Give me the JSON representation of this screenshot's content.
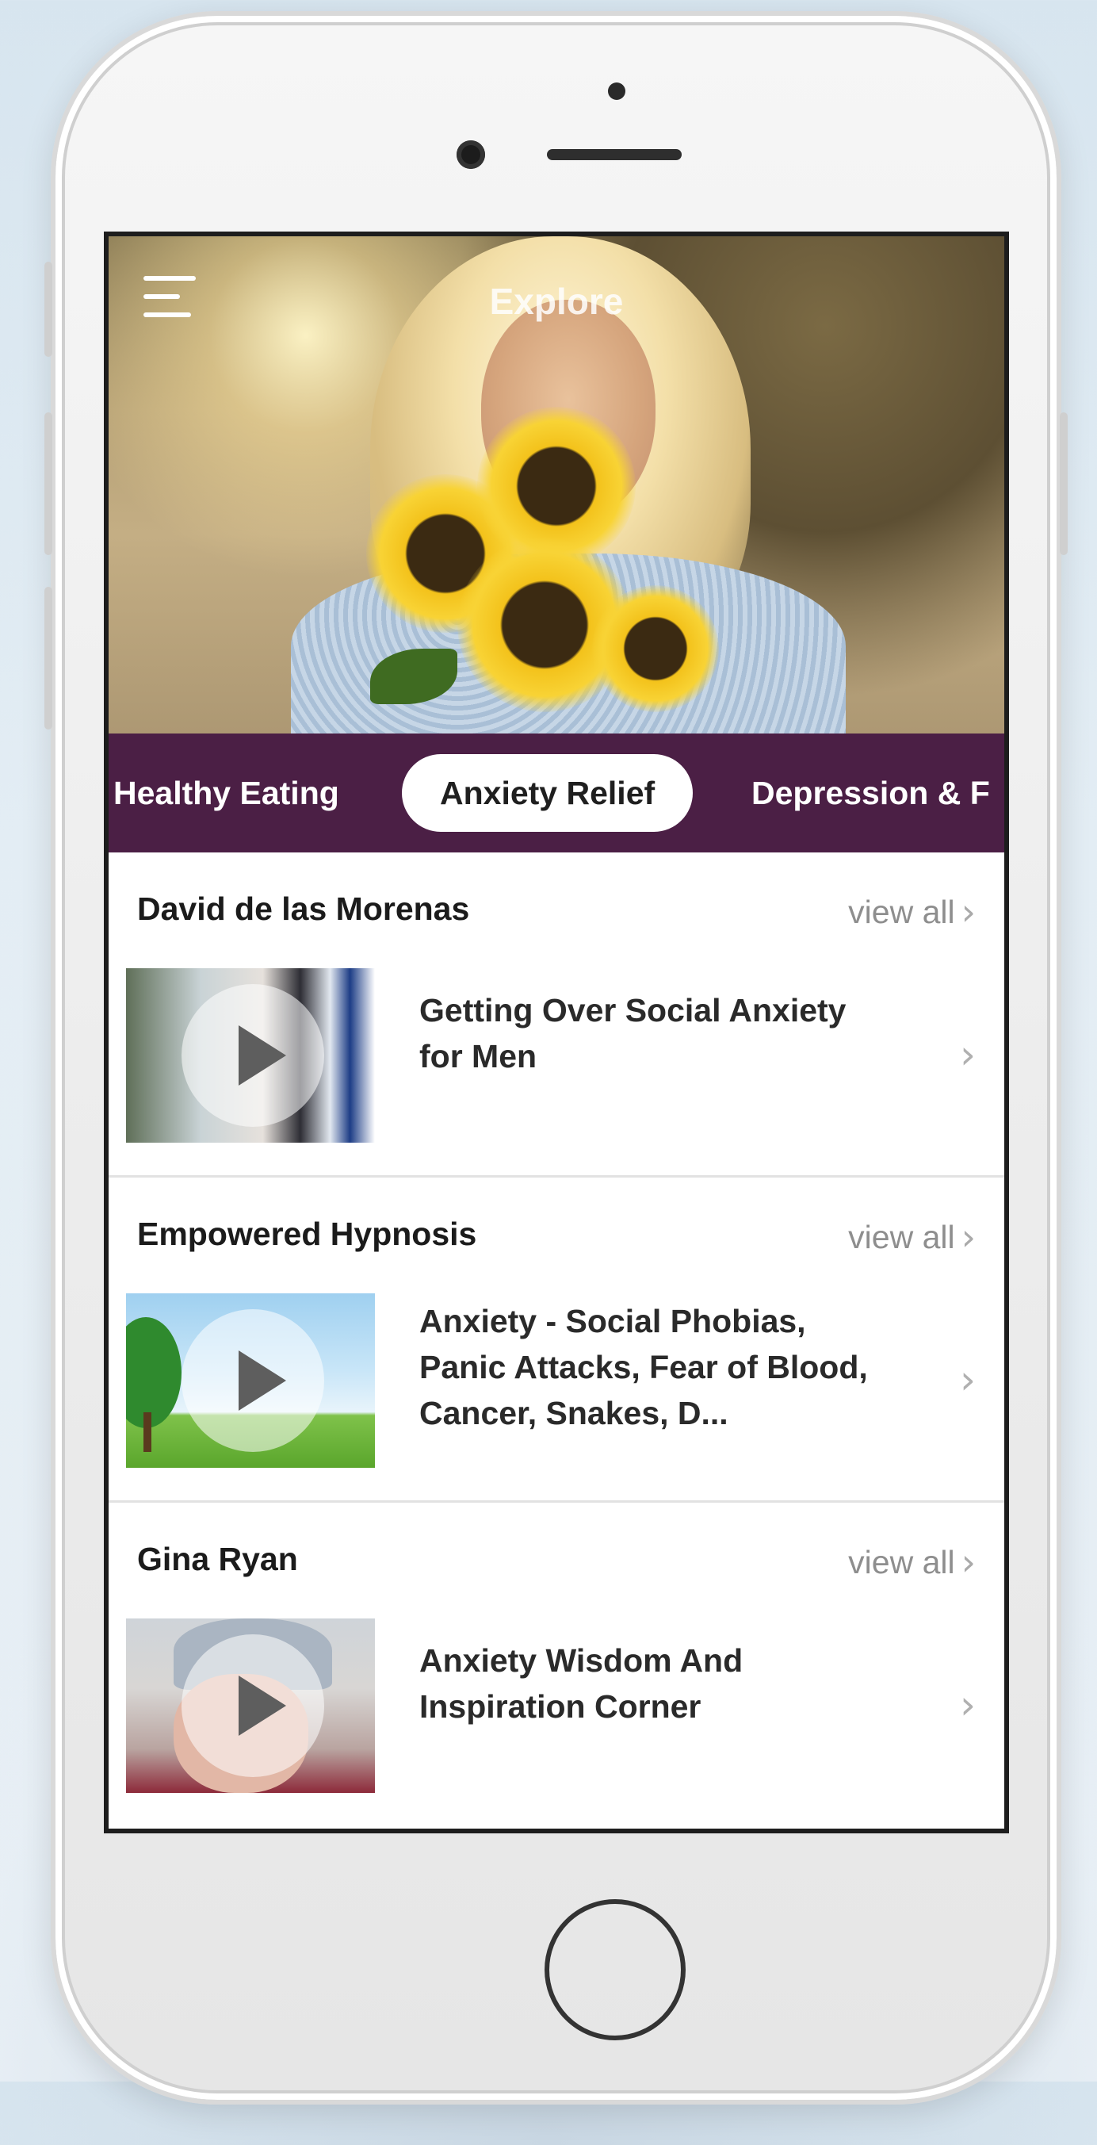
{
  "header": {
    "title": "Explore"
  },
  "tabs": [
    {
      "label": "Healthy Eating",
      "active": false
    },
    {
      "label": "Anxiety Relief",
      "active": true
    },
    {
      "label": "Depression & F",
      "active": false
    }
  ],
  "sections": [
    {
      "author": "David de las Morenas",
      "view_all": "view all",
      "item_title": "Getting Over Social Anxiety for Men"
    },
    {
      "author": "Empowered Hypnosis",
      "view_all": "view all",
      "item_title": "Anxiety - Social Phobias, Panic Attacks, Fear of Blood, Cancer, Snakes, D..."
    },
    {
      "author": "Gina Ryan",
      "view_all": "view all",
      "item_title": "Anxiety Wisdom And Inspiration Corner"
    }
  ],
  "icons": {
    "menu": "hamburger-menu-icon",
    "chevron": "chevron-right-icon",
    "play": "play-icon"
  },
  "colors": {
    "tab_bar": "#4b1f45",
    "active_tab_bg": "#ffffff",
    "muted_text": "#8e8e8e"
  }
}
